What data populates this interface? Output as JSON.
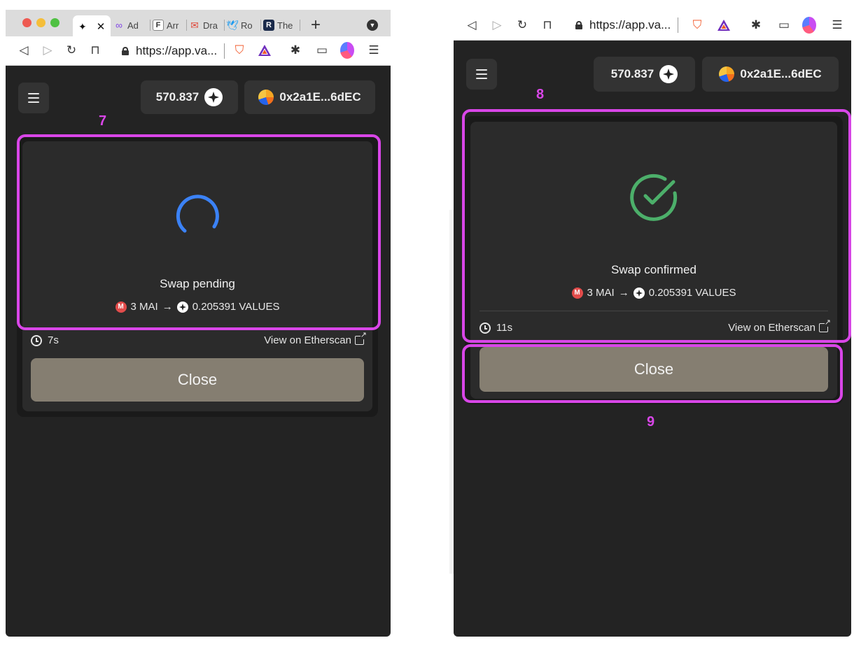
{
  "left": {
    "tabs": [
      {
        "label": "",
        "favicon": "values-star-icon"
      },
      {
        "label": "Ad",
        "favicon": "polygon-icon"
      },
      {
        "label": "Arr",
        "favicon": "f-icon"
      },
      {
        "label": "Dra",
        "favicon": "gmail-icon"
      },
      {
        "label": "Ro",
        "favicon": "twitter-icon"
      },
      {
        "label": "The",
        "favicon": "r-icon"
      }
    ],
    "url": "https://app.va...",
    "balance": "570.837",
    "address": "0x2a1E...6dEC",
    "status": "Swap pending",
    "swap": {
      "from_amount": "3 MAI",
      "arrow": "→",
      "to_amount": "0.205391 VALUES"
    },
    "elapsed": "7s",
    "etherscan": "View on Etherscan",
    "close_label": "Close",
    "step_label": "7"
  },
  "right": {
    "url": "https://app.va...",
    "balance": "570.837",
    "address": "0x2a1E...6dEC",
    "status": "Swap confirmed",
    "swap": {
      "from_amount": "3 MAI",
      "arrow": "→",
      "to_amount": "0.205391 VALUES"
    },
    "elapsed": "11s",
    "etherscan": "View on Etherscan",
    "close_label": "Close",
    "step_label_card": "8",
    "step_label_close": "9"
  },
  "colors": {
    "highlight": "#d946e8",
    "spinner": "#3b82f6",
    "success": "#4caf6a",
    "close_button": "#857e71",
    "panel": "#232323"
  }
}
